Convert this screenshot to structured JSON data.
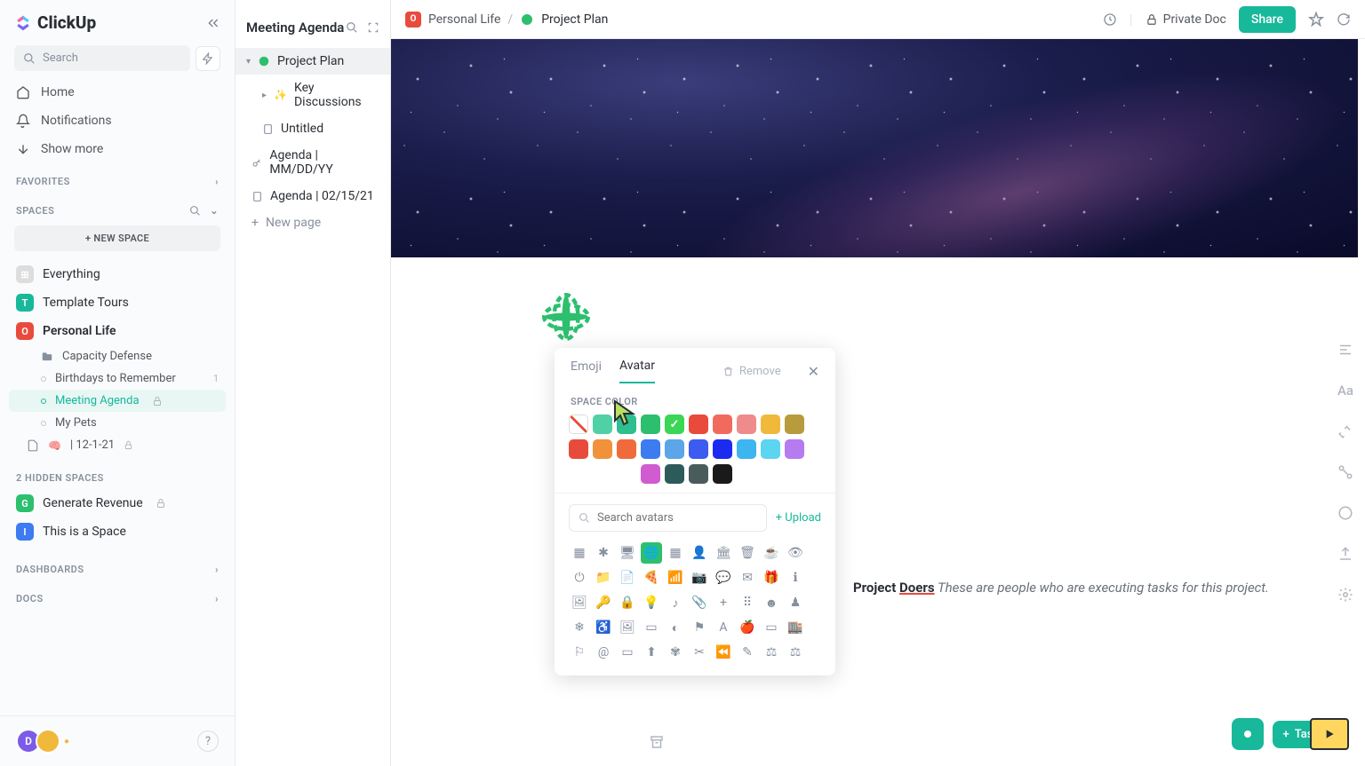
{
  "logo": "ClickUp",
  "search_placeholder": "Search",
  "nav": {
    "home": "Home",
    "notifications": "Notifications",
    "showmore": "Show more"
  },
  "favorites_label": "FAVORITES",
  "spaces_label": "SPACES",
  "new_space": "+  NEW SPACE",
  "spaces": {
    "everything": "Everything",
    "template": "Template Tours",
    "personal": "Personal Life",
    "sub_capacity": "Capacity Defense",
    "sub_birthdays": "Birthdays to Remember",
    "sub_birthdays_count": "1",
    "sub_meeting": "Meeting Agenda",
    "sub_pets": "My Pets",
    "sub_date": "| 12-1-21"
  },
  "hidden_label": "2 HIDDEN SPACES",
  "hidden": {
    "gen": "Generate Revenue",
    "space": "This is a Space"
  },
  "dashboards": "DASHBOARDS",
  "docs": "DOCS",
  "panel2": {
    "title": "Meeting Agenda",
    "project": "Project Plan",
    "key": "Key Discussions",
    "untitled": "Untitled",
    "agenda1": "Agenda | MM/DD/YY",
    "agenda2": "Agenda | 02/15/21",
    "newpage": "New page"
  },
  "breadcrumb": {
    "space": "Personal Life",
    "doc": "Project Plan"
  },
  "topbar": {
    "private": "Private Doc",
    "share": "Share"
  },
  "picker": {
    "tab_emoji": "Emoji",
    "tab_avatar": "Avatar",
    "remove": "Remove",
    "space_color": "SPACE COLOR",
    "search_placeholder": "Search avatars",
    "upload": "+ Upload",
    "colors_row1": [
      "none",
      "#4fd1a5",
      "#2dbf8e",
      "#2dbf6e",
      "#3ad655",
      "#e84b3c",
      "#f06b5d",
      "#f08b8b",
      "#f0b93c",
      "#b89b3c"
    ],
    "colors_row2": [
      "#e84b3c",
      "#f0923c",
      "#f06b3c",
      "#3c7bf0",
      "#5ba5e8",
      "#3c5bf0",
      "#1c2bf0",
      "#3cb5f0",
      "#5bd5f0",
      "#b57bf0"
    ],
    "colors_row3": [
      "#d15bd1",
      "#2d5b5b",
      "#4a5b5b",
      "#1a1a1a"
    ]
  },
  "doc": {
    "proj_doers_label": "Project ",
    "doers": "Doers",
    "doers_text": " These are people who are executing tasks for this project."
  },
  "fab": {
    "task": "Task"
  }
}
